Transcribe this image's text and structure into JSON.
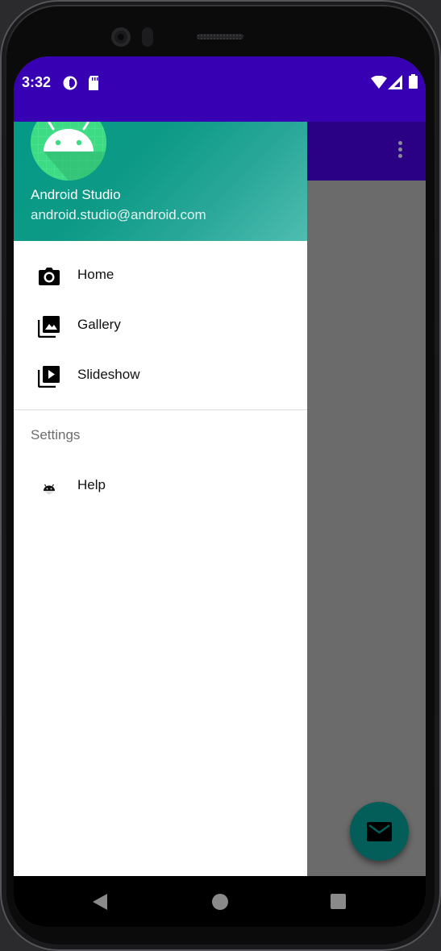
{
  "status_bar": {
    "time": "3:32",
    "left_icons": [
      "data-saver-icon",
      "sd-card-icon"
    ],
    "right_icons": [
      "wifi-icon",
      "signal-icon",
      "battery-icon"
    ],
    "color": "#3700b3"
  },
  "app_bar": {
    "color": "#2a0084",
    "overflow_icon": "more-vert-icon"
  },
  "drawer": {
    "header": {
      "name": "Android Studio",
      "email": "android.studio@android.com",
      "avatar_icon": "android-robot-icon"
    },
    "items": [
      {
        "label": "Home",
        "icon": "camera-icon"
      },
      {
        "label": "Gallery",
        "icon": "gallery-icon"
      },
      {
        "label": "Slideshow",
        "icon": "slideshow-icon"
      }
    ],
    "section": {
      "title": "Settings",
      "items": [
        {
          "label": "Help",
          "icon": "android-small-icon"
        }
      ]
    }
  },
  "fab": {
    "icon": "email-icon",
    "color": "#035d58"
  },
  "nav_bar": {
    "buttons": [
      "back-icon",
      "home-icon",
      "recents-icon"
    ]
  }
}
